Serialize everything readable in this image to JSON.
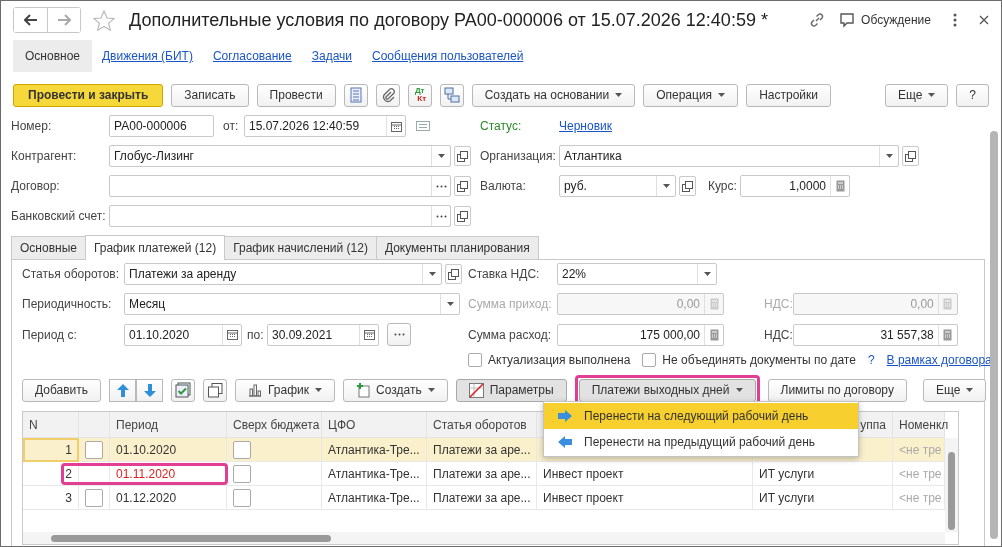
{
  "window": {
    "title": "Дополнительные условия по договору РА00-000006 от 15.07.2026 12:40:59 *",
    "discussion": "Обсуждение"
  },
  "nav": [
    {
      "label": "Основное",
      "selected": true
    },
    {
      "label": "Движения (БИТ)",
      "selected": false
    },
    {
      "label": "Согласование",
      "selected": false
    },
    {
      "label": "Задачи",
      "selected": false
    },
    {
      "label": "Сообщения пользователей",
      "selected": false
    }
  ],
  "toolbar": {
    "left": [
      {
        "kind": "primary",
        "label": "Провести и закрыть"
      },
      {
        "kind": "plain",
        "label": "Записать"
      },
      {
        "kind": "plain",
        "label": "Провести"
      },
      {
        "kind": "list"
      },
      {
        "kind": "clip"
      },
      {
        "kind": "dtkt",
        "top": "Дт",
        "bottom": "Кт"
      },
      {
        "kind": "structure"
      },
      {
        "kind": "menu",
        "label": "Создать на основании"
      },
      {
        "kind": "menu",
        "label": "Операция"
      },
      {
        "kind": "plain",
        "label": "Настройки"
      }
    ],
    "right": [
      {
        "kind": "menu",
        "label": "Еще"
      },
      {
        "kind": "plain",
        "label": "?"
      }
    ]
  },
  "header": {
    "number": {
      "label": "Номер:",
      "value": "РА00-000006"
    },
    "date": {
      "label": "от:",
      "value": "15.07.2026 12:40:59"
    },
    "status": {
      "label": "Статус:",
      "value": "Черновик"
    },
    "counterparty": {
      "label": "Контрагент:",
      "value": "Глобус-Лизинг"
    },
    "organization": {
      "label": "Организация:",
      "value": "Атлантика"
    },
    "contract": {
      "label": "Договор:"
    },
    "currency": {
      "label": "Валюта:",
      "value": "руб."
    },
    "rate": {
      "label": "Курс:",
      "value": "1,0000"
    },
    "bank_account": {
      "label": "Банковский счет:"
    }
  },
  "tabs": [
    {
      "label": "Основные",
      "selected": false
    },
    {
      "label": "График платежей (12)",
      "selected": true
    },
    {
      "label": "График начислений (12)",
      "selected": false
    },
    {
      "label": "Документы планирования",
      "selected": false
    }
  ],
  "schedule": {
    "item": {
      "label": "Статья оборотов:",
      "value": "Платежи за аренду"
    },
    "vat_rate": {
      "label": "Ставка НДС:",
      "value": "22%"
    },
    "periodicity": {
      "label": "Периодичность:",
      "value": "Месяц"
    },
    "income": {
      "label": "Сумма приход:",
      "value": "0,00",
      "disabled": true
    },
    "income_vat": {
      "label": "НДС:",
      "value": "0,00",
      "disabled": true
    },
    "period_from": {
      "label": "Период с:",
      "value": "01.10.2020"
    },
    "period_to": {
      "label": "по:",
      "value": "30.09.2021"
    },
    "expense": {
      "label": "Сумма расход:",
      "value": "175 000,00",
      "disabled": false
    },
    "expense_vat": {
      "label": "НДС:",
      "value": "31 557,38",
      "disabled": false
    },
    "checkboxes": [
      {
        "label": "Актуализация выполнена",
        "checked": false
      },
      {
        "label": "Не объединять документы по дате",
        "checked": false
      }
    ],
    "help": "?",
    "link": "В рамках договора"
  },
  "table_toolbar": {
    "left": [
      {
        "kind": "plain",
        "label": "Добавить",
        "pressed": false,
        "highlighted": false
      },
      {
        "kind": "updown"
      },
      {
        "kind": "checklist"
      },
      {
        "kind": "copy"
      },
      {
        "kind": "graph",
        "label": "График",
        "pressed": false,
        "highlighted": false
      },
      {
        "kind": "create",
        "label": "Создать",
        "pressed": false,
        "highlighted": false
      },
      {
        "kind": "params",
        "label": "Параметры",
        "pressed": true,
        "highlighted": false
      },
      {
        "kind": "menu",
        "label": "Платежи выходных дней",
        "pressed": true,
        "highlighted": true
      },
      {
        "kind": "plain",
        "label": "Лимиты по договору",
        "pressed": false,
        "highlighted": false
      }
    ],
    "right": [
      {
        "kind": "menu",
        "label": "Еще",
        "pressed": false,
        "highlighted": false
      }
    ]
  },
  "table": {
    "columns": {
      "n": "N",
      "period": "Период",
      "over_budget": "Сверх бюджета",
      "cfo": "ЦФО",
      "item": "Статья оборотов",
      "group": "уппа",
      "nomenclature": "Номенкл"
    },
    "rows": [
      {
        "n": "1",
        "checked": false,
        "period": "01.10.2020",
        "over_budget": false,
        "cfo": "Атлантика-Тре...",
        "item": "Платежи за аре...",
        "nomenclature": "<не тре",
        "selected": true,
        "highlighted": false,
        "alert": false
      },
      {
        "n": "2",
        "period": "01.11.2020",
        "over_budget": false,
        "cfo": "Атлантика-Тре...",
        "item": "Платежи за аре...",
        "project": "Инвест проект",
        "group": "ИТ услуги",
        "nomenclature": "<не тре",
        "selected": false,
        "highlighted": true,
        "alert": true
      },
      {
        "n": "3",
        "checked": false,
        "period": "01.12.2020",
        "over_budget": false,
        "cfo": "Атлантика-Тре...",
        "item": "Платежи за аре...",
        "project": "Инвест проект",
        "group": "ИТ услуги",
        "nomenclature": "<не тре",
        "selected": false,
        "highlighted": false,
        "alert": false
      }
    ]
  },
  "menu": [
    {
      "kind": "next",
      "label": "Перенести на следующий рабочий день",
      "selected": true
    },
    {
      "kind": "prev",
      "label": "Перенести на предыдущий рабочий день",
      "selected": false
    }
  ]
}
